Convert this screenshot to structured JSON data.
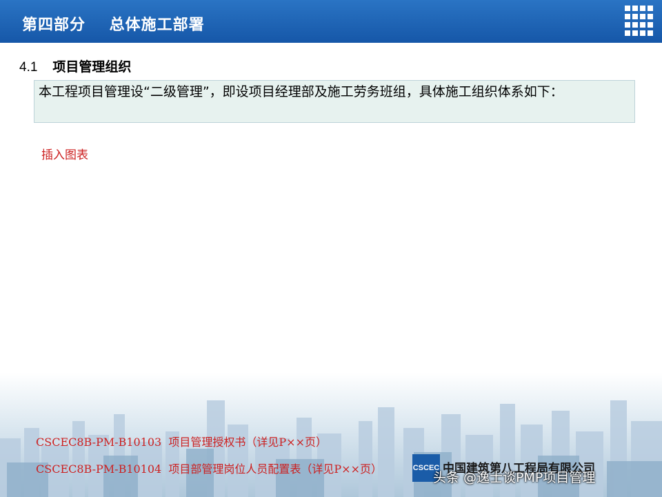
{
  "header": {
    "title": "第四部分    总体施工部署",
    "logo_icon": "building-grid-logo-icon"
  },
  "section": {
    "number": "4.1",
    "title": "项目管理组织"
  },
  "intro": {
    "text": "本工程项目管理设“二级管理”，即设项目经理部及施工劳务班组，具体施工组织体系如下："
  },
  "placeholder": {
    "text": "插入图表"
  },
  "references": [
    "CSCEC8B-PM-B10103  项目管理授权书（详见P××页）",
    "CSCEC8B-PM-B10104  项目部管理岗位人员配置表（详见P××页）"
  ],
  "footer": {
    "logo_text": "CSCEC",
    "company": "中国建筑第八工程局有限公司",
    "watermark": "头条 @逸士谈PMP项目管理"
  },
  "colors": {
    "header_blue": "#1a5ca8",
    "accent_red": "#cc1f1f",
    "box_bg": "#e7f2ef"
  }
}
